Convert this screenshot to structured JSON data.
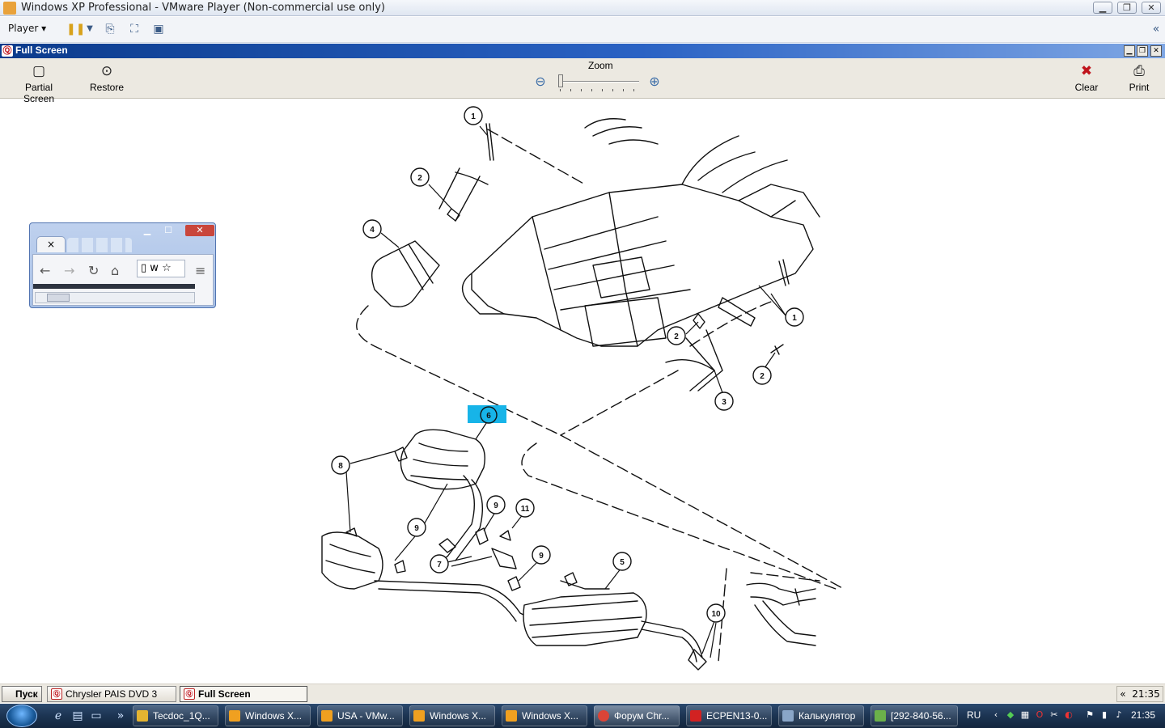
{
  "vmware": {
    "title": "Windows XP Professional - VMware Player (Non-commercial use only)",
    "player_menu": "Player",
    "collapse_glyph": "«"
  },
  "app": {
    "header_title": "Full Screen",
    "toolbar": {
      "partial_screen": "Partial Screen",
      "restore": "Restore",
      "zoom": "Zoom",
      "clear": "Clear",
      "print": "Print"
    }
  },
  "diagram": {
    "callouts": [
      "1",
      "2",
      "4",
      "1",
      "2",
      "2",
      "3",
      "6",
      "8",
      "9",
      "11",
      "9",
      "7",
      "9",
      "5",
      "10"
    ]
  },
  "mini_browser": {
    "tab_close": "×",
    "omnibox_text": "w"
  },
  "inner_taskbar": {
    "start": "Пуск",
    "tasks": [
      "Chrysler PAIS DVD 3",
      "Full Screen"
    ],
    "clock": "21:35",
    "collapse": "«"
  },
  "win7_taskbar": {
    "tasks": [
      {
        "label": "Tecdoc_1Q...",
        "icon_color": "#e4b431"
      },
      {
        "label": "Windows X...",
        "icon_color": "#f0a020"
      },
      {
        "label": "USA - VMw...",
        "icon_color": "#f0a020"
      },
      {
        "label": "Windows X...",
        "icon_color": "#f0a020"
      },
      {
        "label": "Windows X...",
        "icon_color": "#f0a020"
      },
      {
        "label": "Форум Chr...",
        "icon_color": "#db4437"
      },
      {
        "label": "ECPEN13-0...",
        "icon_color": "#d22222"
      },
      {
        "label": "Калькулятор",
        "icon_color": "#8aa6c8"
      },
      {
        "label": "[292-840-56...",
        "icon_color": "#6bb04a"
      }
    ],
    "language": "RU",
    "clock": "21:35"
  }
}
